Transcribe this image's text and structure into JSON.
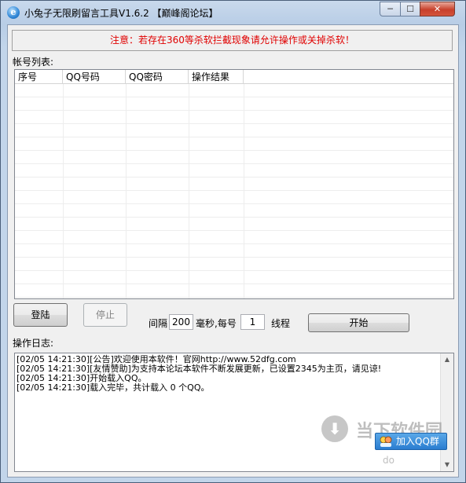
{
  "window": {
    "title": "小兔子无限刷留言工具V1.6.2 【巅峰阁论坛】",
    "icon": "ie-icon",
    "controls": {
      "minimize": "─",
      "maximize": "☐",
      "close": "✕"
    }
  },
  "notice": "注意：若存在360等杀软拦截现象请允许操作或关掉杀软！",
  "accounts": {
    "label": "帐号列表:",
    "columns": [
      "序号",
      "QQ号码",
      "QQ密码",
      "操作结果"
    ],
    "rows": []
  },
  "controls": {
    "login_label": "登陆",
    "stop_label": "停止",
    "interval_label": "间隔",
    "interval_value": "200",
    "per_label": "毫秒,每号",
    "threads_value": "1",
    "threads_label": "线程",
    "start_label": "开始"
  },
  "log": {
    "label": "操作日志:",
    "lines": [
      "[02/05 14:21:30][公告]欢迎使用本软件！官网http://www.52dfg.com",
      "[02/05 14:21:30][友情赞助]为支持本论坛本软件不断发展更新，已设置2345为主页，请见谅!",
      "[02/05 14:21:30]开始载入QQ。",
      "[02/05 14:21:30]载入完毕，共计载入 0 个QQ。"
    ]
  },
  "watermark": {
    "text": "当下软件园",
    "small": "do"
  },
  "qq_group": {
    "label": "加入QQ群"
  },
  "colors": {
    "notice_text": "#e00000",
    "qq_button": "#2a7dd0"
  }
}
